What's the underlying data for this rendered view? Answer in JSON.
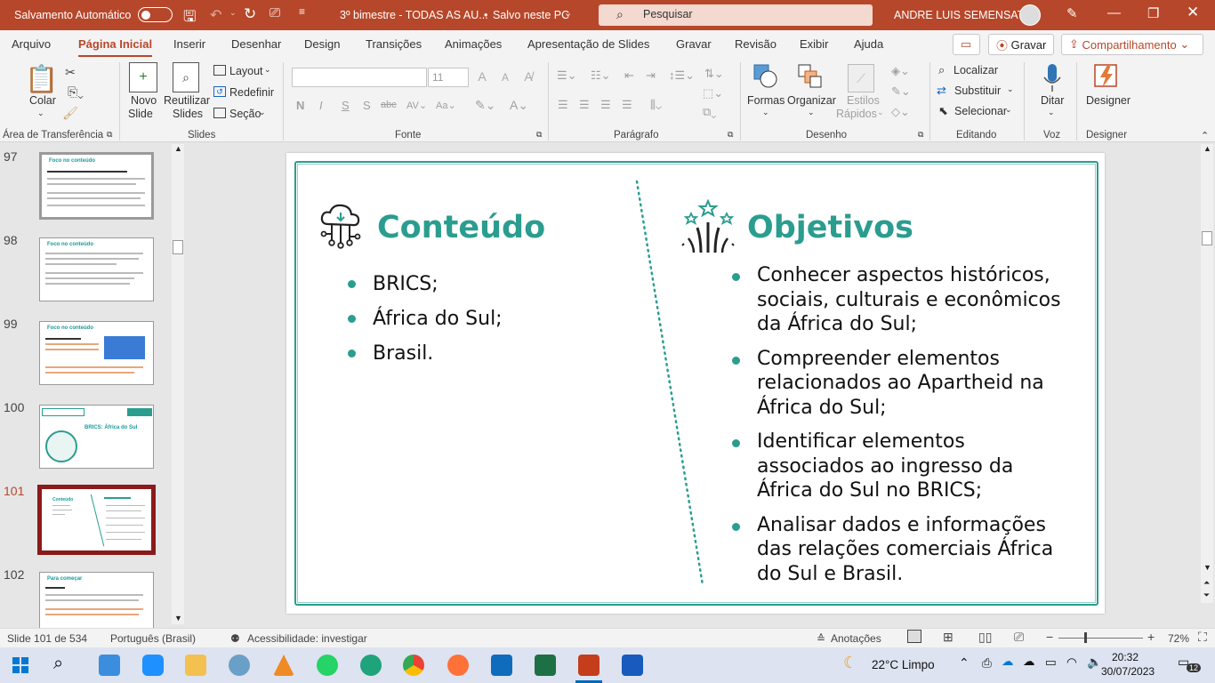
{
  "titlebar": {
    "autosave_label": "Salvamento Automático",
    "autosave_state": "off",
    "filename": "3º bimestre - TODAS AS AU...",
    "save_status": "Salvo neste PC",
    "search_placeholder": "Pesquisar",
    "user_name": "ANDRE LUIS SEMENSATO",
    "accent_color": "#b7472a"
  },
  "tabs": {
    "items": [
      "Arquivo",
      "Página Inicial",
      "Inserir",
      "Desenhar",
      "Design",
      "Transições",
      "Animações",
      "Apresentação de Slides",
      "Gravar",
      "Revisão",
      "Exibir",
      "Ajuda"
    ],
    "active": "Página Inicial",
    "record_button": "Gravar",
    "share_button": "Compartilhamento"
  },
  "ribbon": {
    "clipboard": {
      "paste": "Colar",
      "group": "Área de Transferência"
    },
    "slides": {
      "new_slide_1": "Novo",
      "new_slide_2": "Slide",
      "reuse_1": "Reutilizar",
      "reuse_2": "Slides",
      "layout": "Layout",
      "reset": "Redefinir",
      "section": "Seção",
      "group": "Slides"
    },
    "font": {
      "font_size": "11",
      "bold": "N",
      "italic": "I",
      "underline": "S",
      "strike": "S",
      "group": "Fonte"
    },
    "paragraph": {
      "group": "Parágrafo"
    },
    "drawing": {
      "shapes": "Formas",
      "arrange": "Organizar",
      "styles_1": "Estilos",
      "styles_2": "Rápidos",
      "group": "Desenho"
    },
    "editing": {
      "find": "Localizar",
      "replace": "Substituir",
      "select": "Selecionar",
      "group": "Editando"
    },
    "voice": {
      "dictate": "Ditar",
      "group": "Voz"
    },
    "designer": {
      "label": "Designer",
      "group": "Designer"
    }
  },
  "thumbnails": [
    {
      "number": "97",
      "title": "Foco no conteúdo"
    },
    {
      "number": "98",
      "title": "Foco no conteúdo"
    },
    {
      "number": "99",
      "title": "Foco no conteúdo"
    },
    {
      "number": "100",
      "title": "BRICS: África do Sul"
    },
    {
      "number": "101",
      "title": "Conteúdo"
    },
    {
      "number": "102",
      "title": "Para começar"
    }
  ],
  "slide": {
    "content_heading": "Conteúdo",
    "content_items": [
      "BRICS;",
      "África do Sul;",
      "Brasil."
    ],
    "objectives_heading": "Objetivos",
    "objective_items": [
      [
        "Conhecer aspectos históricos,",
        "sociais, culturais e econômicos",
        "da África do Sul;"
      ],
      [
        "Compreender elementos",
        "relacionados ao Apartheid na",
        "África do Sul;"
      ],
      [
        "Identificar elementos",
        "associados ao ingresso da",
        "África do Sul no BRICS;"
      ],
      [
        "Analisar dados e informações",
        "das relações comerciais África",
        "do Sul e Brasil."
      ]
    ],
    "accent_color": "#2a9d8f"
  },
  "statusbar": {
    "slide_info": "Slide 101 de 534",
    "language": "Português (Brasil)",
    "accessibility": "Acessibilidade: investigar",
    "notes": "Anotações",
    "zoom": "72%"
  },
  "taskbar": {
    "weather": "22°C  Limpo",
    "time": "20:32",
    "date": "30/07/2023",
    "notifications": "12"
  }
}
